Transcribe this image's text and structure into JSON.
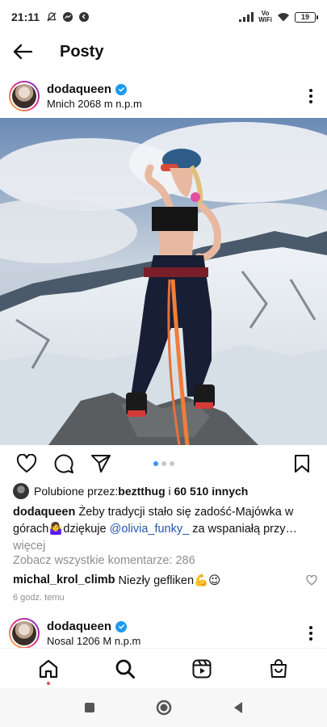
{
  "status_bar": {
    "time": "21:11",
    "network_label_top": "Vo",
    "network_label_bottom": "WiFi",
    "battery": "19"
  },
  "header": {
    "title": "Posty"
  },
  "post": {
    "username": "dodaqueen",
    "location": "Mnich 2068 m n.p.m",
    "likes_prefix": "Polubione przez: ",
    "liked_by": "beztthug",
    "likes_and": " i ",
    "likes_others": "60 510 innych",
    "caption_user": "dodaqueen",
    "caption_text": " Żeby tradycji stało się zadość-Majówka w górach🤷‍♀️dziękuje ",
    "caption_mention": "@olivia_funky_",
    "caption_tail": " za wspaniałą przy…",
    "caption_more": "więcej",
    "view_comments": "Zobacz wszystkie komentarze: 286",
    "comment_user": "michal_krol_climb",
    "comment_text": " Niezły gefliken💪😉",
    "time_ago": "6 godz. temu",
    "carousel_count": 3,
    "carousel_active": 1
  },
  "next_post": {
    "username": "dodaqueen",
    "location": "Nosal 1206 M n.p.m"
  },
  "bottom_nav": {
    "items": [
      "home-icon",
      "search-icon",
      "reels-icon",
      "shop-icon"
    ]
  },
  "colors": {
    "accent": "#3897f0",
    "verified": "#1d9bf0",
    "mention": "#2455a8",
    "muted": "#8e8e8e",
    "notification": "#ed4956"
  }
}
